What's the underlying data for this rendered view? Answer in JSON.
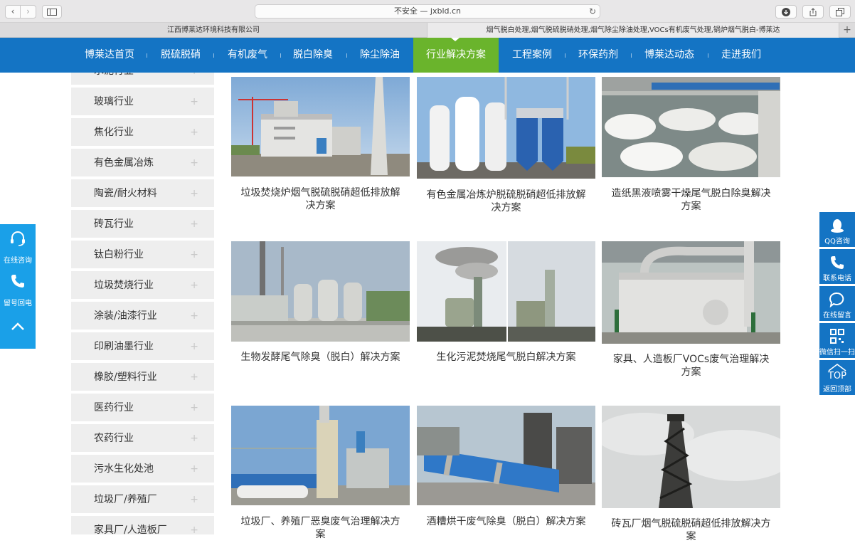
{
  "browser": {
    "address": "不安全 — jxbld.cn",
    "tabs": [
      {
        "label": "江西博莱达环境科技有限公司"
      },
      {
        "label": "烟气脱白处理,烟气脱硫脱硝处理,烟气除尘除油处理,VOCs有机废气处理,锅炉烟气脱白-博莱达"
      }
    ],
    "new_tab": "+"
  },
  "nav": {
    "items": [
      {
        "label": "博莱达首页"
      },
      {
        "label": "脱硫脱硝"
      },
      {
        "label": "有机废气"
      },
      {
        "label": "脱白除臭"
      },
      {
        "label": "除尘除油"
      },
      {
        "label": "行业解决方案"
      },
      {
        "label": "工程案例"
      },
      {
        "label": "环保药剂"
      },
      {
        "label": "博莱达动态"
      },
      {
        "label": "走进我们"
      }
    ],
    "active_color": "#6ab42c",
    "bar_color": "#1474c4"
  },
  "sidebar": {
    "items": [
      {
        "label": "水泥行业"
      },
      {
        "label": "玻璃行业"
      },
      {
        "label": "焦化行业"
      },
      {
        "label": "有色金属冶炼"
      },
      {
        "label": "陶瓷/耐火材料"
      },
      {
        "label": "砖瓦行业"
      },
      {
        "label": "钛白粉行业"
      },
      {
        "label": "垃圾焚烧行业"
      },
      {
        "label": "涂装/油漆行业"
      },
      {
        "label": "印刷油墨行业"
      },
      {
        "label": "橡胶/塑料行业"
      },
      {
        "label": "医药行业"
      },
      {
        "label": "农药行业"
      },
      {
        "label": "污水生化处池"
      },
      {
        "label": "垃圾厂/养殖厂"
      },
      {
        "label": "家具厂/人造板厂"
      }
    ],
    "expand_symbol": "+"
  },
  "solutions": [
    {
      "title": "垃圾焚烧炉烟气脱硫脱硝超低排放解决方案"
    },
    {
      "title": "有色金属冶炼炉脱硫脱硝超低排放解决方案"
    },
    {
      "title": "造纸黑液喷雾干燥尾气脱白除臭解决方案"
    },
    {
      "title": "生物发酵尾气除臭（脱白）解决方案"
    },
    {
      "title": "生化污泥焚烧尾气脱白解决方案"
    },
    {
      "title": "家具、人造板厂VOCs废气治理解决方案"
    },
    {
      "title": "垃圾厂、养殖厂恶臭废气治理解决方案"
    },
    {
      "title": "酒糟烘干废气除臭（脱白）解决方案"
    },
    {
      "title": "砖瓦厂烟气脱硫脱硝超低排放解决方案"
    }
  ],
  "float_left": [
    {
      "label": "在线咨询",
      "icon": "headset-icon"
    },
    {
      "label": "留号回电",
      "icon": "phone-icon"
    },
    {
      "label": "",
      "icon": "arrow-up-icon"
    }
  ],
  "float_right": [
    {
      "label": "QQ咨询",
      "icon": "qq-icon"
    },
    {
      "label": "联系电话",
      "icon": "phone-icon"
    },
    {
      "label": "在线留言",
      "icon": "chat-icon"
    },
    {
      "label": "微信扫一扫",
      "icon": "qrcode-icon"
    },
    {
      "label": "返回顶部",
      "icon": "top-icon",
      "badge": "TOP"
    }
  ],
  "float_color_left": "#1aa0e8",
  "float_color_right": "#1474c4"
}
